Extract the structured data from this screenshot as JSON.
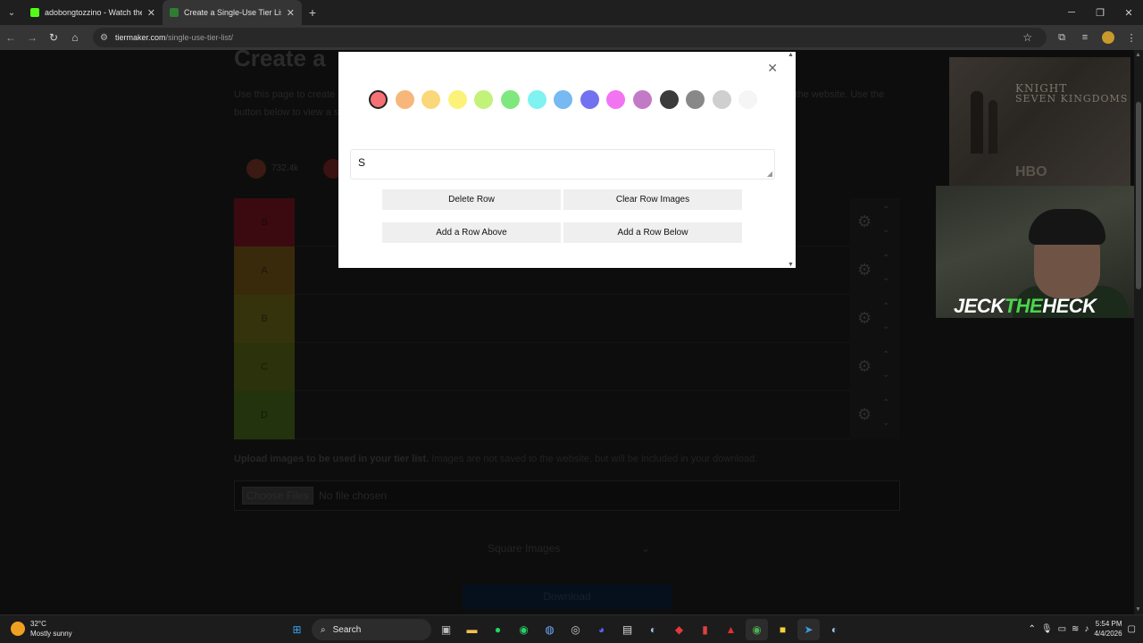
{
  "browser": {
    "tabs": [
      {
        "title": "adobongtozzino - Watch the V",
        "favicon_color": "#53fc18",
        "active": false
      },
      {
        "title": "Create a Single-Use Tier List (P",
        "favicon_color": "#2e7d32",
        "active": true
      }
    ],
    "url_host": "tiermaker.com",
    "url_path": "/single-use-tier-list/"
  },
  "page": {
    "title": "Create a",
    "intro": "Use this page to create a single-use tier list. Use the Upload button below to add images to your tier list. Images are not saved to the website. Use the button below to view a single-use tier list where it will be possible to save a single-use tier list.",
    "reaction_count": "732.4k",
    "tiers": [
      {
        "label": "S",
        "color": "#3a0a10"
      },
      {
        "label": "A",
        "color": "#3a2a0c"
      },
      {
        "label": "B",
        "color": "#35330c"
      },
      {
        "label": "C",
        "color": "#2c330c"
      },
      {
        "label": "D",
        "color": "#22330e"
      }
    ],
    "upload_note_bold": "Upload images to be used in your tier list.",
    "upload_note": " Images are not saved to the website, but will be included in your download.",
    "choose_files": "Choose Files",
    "no_file": "No file chosen",
    "image_shape": "Square Images",
    "download": "Download"
  },
  "sidebar_thumb": {
    "line1": "KNIGHT",
    "line2": "SEVEN KINGDOMS",
    "brand": "HBO"
  },
  "webcam": {
    "brand_a": "JECK",
    "brand_b": "THE",
    "brand_c": "HECK"
  },
  "modal": {
    "colors": [
      "#f47174",
      "#f7b77a",
      "#fad778",
      "#fdf279",
      "#c2f27a",
      "#7ee87e",
      "#7ff2f2",
      "#77b9f2",
      "#7272f0",
      "#f374f0",
      "#c27ac7",
      "#3b3b3b",
      "#888888",
      "#cfcfcf",
      "#f5f5f5"
    ],
    "selected_index": 0,
    "label_value": "S",
    "delete_row": "Delete Row",
    "clear_row_images": "Clear Row Images",
    "add_row_above": "Add a Row Above",
    "add_row_below": "Add a Row Below"
  },
  "taskbar": {
    "temp": "32°C",
    "condition": "Mostly sunny",
    "search": "Search",
    "time": "5:54 PM",
    "date": "4/4/2026"
  }
}
